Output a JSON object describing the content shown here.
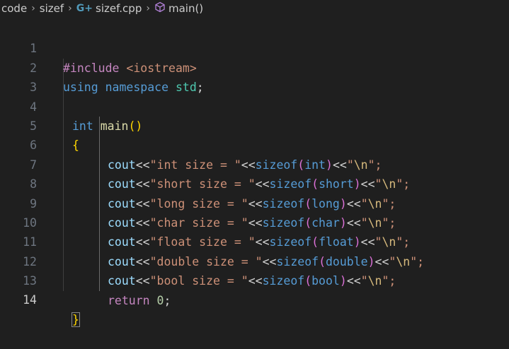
{
  "breadcrumb": {
    "folder1": "code",
    "folder2": "sizef",
    "file": "sizef.cpp",
    "symbol": "main()",
    "file_icon": "cpp-file-icon",
    "symbol_icon": "cube-icon"
  },
  "line_numbers": [
    "1",
    "2",
    "3",
    "4",
    "5",
    "6",
    "7",
    "8",
    "9",
    "10",
    "11",
    "12",
    "13",
    "14"
  ],
  "code": {
    "l1_directive": "#include",
    "l1_header": "<iostream>",
    "l2_using": "using",
    "l2_namespace": "namespace",
    "l2_std": "std",
    "l2_semi": ";",
    "l4_type": "int",
    "l4_name": "main",
    "l4_parens": "()",
    "l5_open": "{",
    "stmt_cout": "cout",
    "stmt_op": "<<",
    "stmt_sizeof": "sizeof",
    "stmt_newline": "\\n",
    "stmt_end": "\";",
    "l6_str": "\"int size = \"",
    "l6_type": "int",
    "l7_str": "\"short size = \"",
    "l7_type": "short",
    "l8_str": "\"long size = \"",
    "l8_type": "long",
    "l9_str": "\"char size = \"",
    "l9_type": "char",
    "l10_str": "\"float size = \"",
    "l10_type": "float",
    "l11_str": "\"double size = \"",
    "l11_type": "double",
    "l12_str": "\"bool size = \"",
    "l12_type": "bool",
    "l13_return": "return",
    "l13_value": "0",
    "l14_close": "}"
  }
}
